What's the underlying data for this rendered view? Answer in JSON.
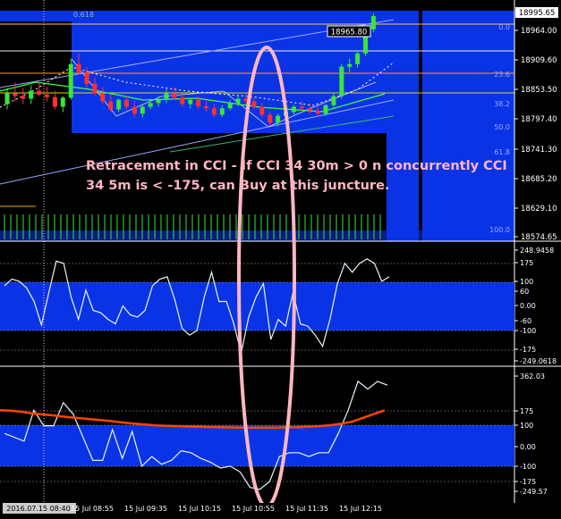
{
  "chart_data": [
    {
      "type": "candlestick",
      "panel": "price",
      "ylim": [
        18574.65,
        19005
      ],
      "y_ticks": [
        "18995.65",
        "18964.00",
        "18909.60",
        "18853.50",
        "18797.40",
        "18741.30",
        "18685.20",
        "18629.10",
        "18574.65"
      ],
      "current_price_label": "18995.65",
      "price_box_label": "18965.80",
      "fib_labels": [
        "0.618",
        "0.0",
        "23.6",
        "38.2",
        "50.0",
        "61.8",
        "100.0"
      ],
      "ohlc": [
        [
          18830,
          18860,
          18820,
          18850
        ],
        [
          18850,
          18870,
          18835,
          18845
        ],
        [
          18845,
          18860,
          18830,
          18840
        ],
        [
          18840,
          18865,
          18830,
          18855
        ],
        [
          18855,
          18870,
          18845,
          18848
        ],
        [
          18848,
          18862,
          18835,
          18843
        ],
        [
          18843,
          18855,
          18820,
          18825
        ],
        [
          18825,
          18845,
          18815,
          18842
        ],
        [
          18842,
          18915,
          18838,
          18905
        ],
        [
          18905,
          18925,
          18885,
          18890
        ],
        [
          18890,
          18900,
          18860,
          18868
        ],
        [
          18868,
          18880,
          18845,
          18850
        ],
        [
          18850,
          18862,
          18830,
          18835
        ],
        [
          18835,
          18848,
          18815,
          18820
        ],
        [
          18820,
          18840,
          18815,
          18838
        ],
        [
          18838,
          18845,
          18820,
          18825
        ],
        [
          18825,
          18835,
          18805,
          18812
        ],
        [
          18812,
          18828,
          18805,
          18825
        ],
        [
          18825,
          18840,
          18820,
          18832
        ],
        [
          18832,
          18845,
          18825,
          18838
        ],
        [
          18838,
          18858,
          18832,
          18850
        ],
        [
          18850,
          18862,
          18838,
          18842
        ],
        [
          18842,
          18850,
          18825,
          18830
        ],
        [
          18830,
          18842,
          18822,
          18838
        ],
        [
          18838,
          18845,
          18820,
          18826
        ],
        [
          18826,
          18838,
          18815,
          18822
        ],
        [
          18822,
          18830,
          18805,
          18810
        ],
        [
          18810,
          18828,
          18806,
          18822
        ],
        [
          18822,
          18838,
          18818,
          18832
        ],
        [
          18832,
          18845,
          18826,
          18840
        ],
        [
          18840,
          18850,
          18830,
          18835
        ],
        [
          18835,
          18842,
          18820,
          18825
        ],
        [
          18825,
          18832,
          18805,
          18810
        ],
        [
          18810,
          18815,
          18790,
          18795
        ],
        [
          18795,
          18812,
          18788,
          18808
        ],
        [
          18808,
          18820,
          18800,
          18815
        ],
        [
          18815,
          18828,
          18810,
          18825
        ],
        [
          18825,
          18835,
          18818,
          18822
        ],
        [
          18822,
          18830,
          18812,
          18818
        ],
        [
          18818,
          18825,
          18808,
          18812
        ],
        [
          18812,
          18830,
          18808,
          18828
        ],
        [
          18828,
          18850,
          18822,
          18845
        ],
        [
          18845,
          18905,
          18840,
          18900
        ],
        [
          18900,
          18915,
          18890,
          18905
        ],
        [
          18905,
          18930,
          18898,
          18925
        ],
        [
          18925,
          18975,
          18920,
          18970
        ],
        [
          18970,
          19000,
          18965,
          18995
        ]
      ]
    },
    {
      "type": "line",
      "panel": "cci-30m",
      "title": "",
      "y_ticks": [
        "248.9458",
        "175",
        "100",
        "60",
        "0.00",
        "-60",
        "-100",
        "-175",
        "-249.0618"
      ],
      "ylim": [
        -249.0618,
        248.9458
      ],
      "series": [
        {
          "values": [
            90,
            120,
            110,
            80,
            20,
            -85,
            60,
            200,
            190,
            40,
            -60,
            70,
            -20,
            -30,
            -60,
            -80,
            0,
            -40,
            -50,
            -20,
            90,
            120,
            130,
            30,
            -100,
            -130,
            -110,
            40,
            150,
            20,
            20,
            -80,
            -210,
            -50,
            40,
            100,
            -150,
            -60,
            -90,
            60,
            -80,
            -90,
            -130,
            -180,
            -60,
            100,
            190,
            150,
            190,
            210,
            190,
            110,
            130
          ]
        }
      ]
    },
    {
      "type": "line",
      "panel": "cci-5m",
      "title": "",
      "y_ticks": [
        "362.03",
        "175",
        "100",
        "0.00",
        "-100",
        "-175",
        "-249.57"
      ],
      "ylim": [
        -249.57,
        362.03
      ],
      "series": [
        {
          "values": [
            60,
            40,
            20,
            180,
            100,
            100,
            220,
            160,
            40,
            -80,
            -80,
            80,
            -70,
            70,
            -110,
            -60,
            -100,
            -80,
            -30,
            -40,
            -70,
            -90,
            -120,
            -110,
            -140,
            -220,
            -230,
            -190,
            -60,
            -40,
            -40,
            -60,
            -40,
            -40,
            60,
            180,
            330,
            290,
            330,
            310
          ]
        },
        {
          "values": [
            180,
            178,
            172,
            163,
            158,
            152,
            145,
            140,
            135,
            130,
            125,
            118,
            112,
            107,
            102,
            100,
            98,
            96,
            95,
            93,
            92,
            91,
            90,
            90,
            90,
            90,
            91,
            92,
            95,
            98,
            102,
            110,
            120,
            140,
            160,
            180
          ]
        }
      ]
    }
  ],
  "x_axis": {
    "tick_labels": [
      "2016.07.15 08:40",
      "15 Jul 08:55",
      "15 Jul 09:35",
      "15 Jul 10:15",
      "15 Jul 10:55",
      "15 Jul 11:35",
      "15 Jul 12:15"
    ]
  },
  "annotation": {
    "text": "Retracement in CCI - If CCI 34 30m > 0 n concurrently CCI 34 5m is < -175, can Buy at this juncture."
  }
}
